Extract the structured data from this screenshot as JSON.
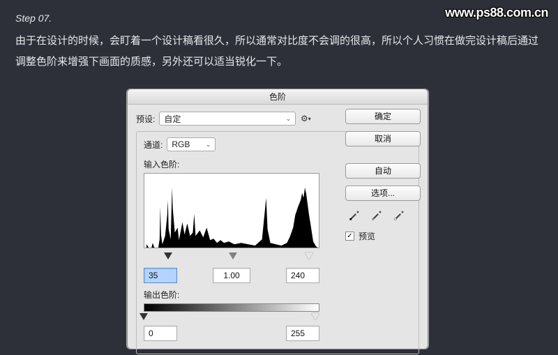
{
  "step_label": "Step 07.",
  "watermark": "www.ps88.com.cn",
  "description": "由于在设计的时候，会盯着一个设计稿看很久，所以通常对比度不会调的很高，所以个人习惯在做完设计稿后通过调整色阶来增强下画面的质感，另外还可以适当锐化一下。",
  "dialog": {
    "title": "色阶",
    "preset_label": "预设:",
    "preset_value": "自定",
    "channel_label": "通道:",
    "channel_value": "RGB",
    "input_levels_label": "输入色阶:",
    "input_black": "35",
    "input_gamma": "1.00",
    "input_white": "240",
    "output_levels_label": "输出色阶:",
    "output_black": "0",
    "output_white": "255"
  },
  "buttons": {
    "ok": "确定",
    "cancel": "取消",
    "auto": "自动",
    "options": "选项..."
  },
  "preview": {
    "label": "预览",
    "checked": true
  },
  "icons": {
    "gear": "⚙",
    "chev": "⌄",
    "check": "✓"
  }
}
